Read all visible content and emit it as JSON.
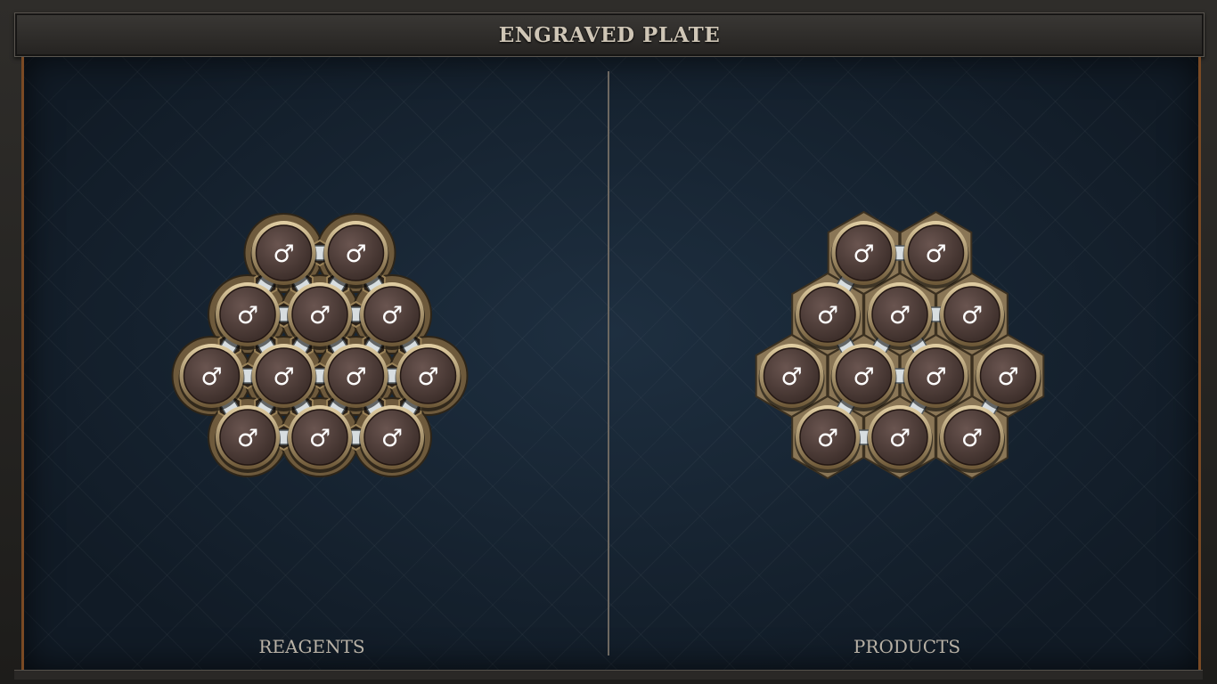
{
  "header": {
    "title": "ENGRAVED PLATE"
  },
  "panels": {
    "left_label": "REAGENTS",
    "right_label": "PRODUCTS"
  },
  "atom_symbol": "♂",
  "atom_element": "salt",
  "reagents": {
    "atoms": [
      {
        "id": "r0",
        "row": 0,
        "col": 1.5
      },
      {
        "id": "r1",
        "row": 0,
        "col": 2.5
      },
      {
        "id": "r2",
        "row": 1,
        "col": 1
      },
      {
        "id": "r3",
        "row": 1,
        "col": 2
      },
      {
        "id": "r4",
        "row": 1,
        "col": 3
      },
      {
        "id": "r5",
        "row": 2,
        "col": 0.5
      },
      {
        "id": "r6",
        "row": 2,
        "col": 1.5
      },
      {
        "id": "r7",
        "row": 2,
        "col": 2.5
      },
      {
        "id": "r8",
        "row": 2,
        "col": 3.5
      },
      {
        "id": "r9",
        "row": 3,
        "col": 1
      },
      {
        "id": "r10",
        "row": 3,
        "col": 2
      },
      {
        "id": "r11",
        "row": 3,
        "col": 3
      }
    ],
    "bonds": [
      [
        "r0",
        "r1"
      ],
      [
        "r0",
        "r2"
      ],
      [
        "r0",
        "r3"
      ],
      [
        "r1",
        "r3"
      ],
      [
        "r1",
        "r4"
      ],
      [
        "r2",
        "r3"
      ],
      [
        "r3",
        "r4"
      ],
      [
        "r2",
        "r5"
      ],
      [
        "r2",
        "r6"
      ],
      [
        "r3",
        "r6"
      ],
      [
        "r3",
        "r7"
      ],
      [
        "r4",
        "r7"
      ],
      [
        "r4",
        "r8"
      ],
      [
        "r5",
        "r6"
      ],
      [
        "r6",
        "r7"
      ],
      [
        "r7",
        "r8"
      ],
      [
        "r5",
        "r9"
      ],
      [
        "r6",
        "r9"
      ],
      [
        "r6",
        "r10"
      ],
      [
        "r7",
        "r10"
      ],
      [
        "r7",
        "r11"
      ],
      [
        "r8",
        "r11"
      ],
      [
        "r9",
        "r10"
      ],
      [
        "r10",
        "r11"
      ]
    ]
  },
  "products": {
    "atoms": [
      {
        "id": "p0",
        "row": 0,
        "col": 1.5
      },
      {
        "id": "p1",
        "row": 0,
        "col": 2.5
      },
      {
        "id": "p2",
        "row": 1,
        "col": 1
      },
      {
        "id": "p3",
        "row": 1,
        "col": 2
      },
      {
        "id": "p4",
        "row": 1,
        "col": 3
      },
      {
        "id": "p5",
        "row": 2,
        "col": 0.5
      },
      {
        "id": "p6",
        "row": 2,
        "col": 1.5
      },
      {
        "id": "p7",
        "row": 2,
        "col": 2.5
      },
      {
        "id": "p8",
        "row": 2,
        "col": 3.5
      },
      {
        "id": "p9",
        "row": 3,
        "col": 1
      },
      {
        "id": "p10",
        "row": 3,
        "col": 2
      },
      {
        "id": "p11",
        "row": 3,
        "col": 3
      }
    ],
    "bonds": [
      [
        "p0",
        "p1"
      ],
      [
        "p0",
        "p2"
      ],
      [
        "p3",
        "p4"
      ],
      [
        "p2",
        "p6"
      ],
      [
        "p3",
        "p6"
      ],
      [
        "p3",
        "p7"
      ],
      [
        "p6",
        "p7"
      ],
      [
        "p8",
        "p11"
      ],
      [
        "p6",
        "p9"
      ],
      [
        "p7",
        "p10"
      ],
      [
        "p9",
        "p10"
      ]
    ]
  },
  "colors": {
    "atom_fill": "#3a2c28",
    "atom_rim": "#b8a07a",
    "hex_plate": "#8a7656",
    "bond": "#aeb6bc"
  }
}
